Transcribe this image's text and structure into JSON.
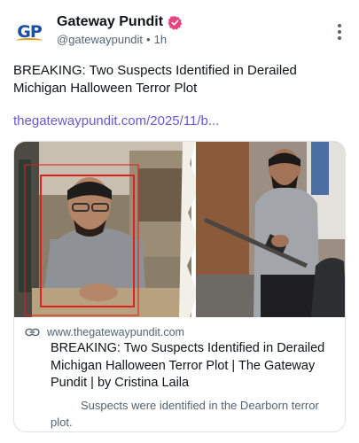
{
  "post": {
    "author": {
      "name": "Gateway Pundit",
      "handle": "@gatewaypundit",
      "separator": "•",
      "time": "1h",
      "avatar_text_g": "G",
      "avatar_text_p": "P",
      "verified_color": "#e8457e"
    },
    "text": "BREAKING: Two Suspects Identified in Derailed Michigan Halloween Terror Plot",
    "link_text": "thegatewaypundit.com/2025/11/b..."
  },
  "card": {
    "domain": "www.thegatewaypundit.com",
    "title": "BREAKING: Two Suspects Identified in Derailed Michigan Halloween Terror Plot | The Gateway Pundit | by Cristina Laila",
    "description": "Suspects were identified in the Dearborn terror plot.",
    "image_icon": "link-icon"
  },
  "colors": {
    "link": "#6a59c9",
    "secondary_text": "#536471",
    "brand_blue": "#1a4fa3",
    "highlight_box": "#e0201c"
  }
}
